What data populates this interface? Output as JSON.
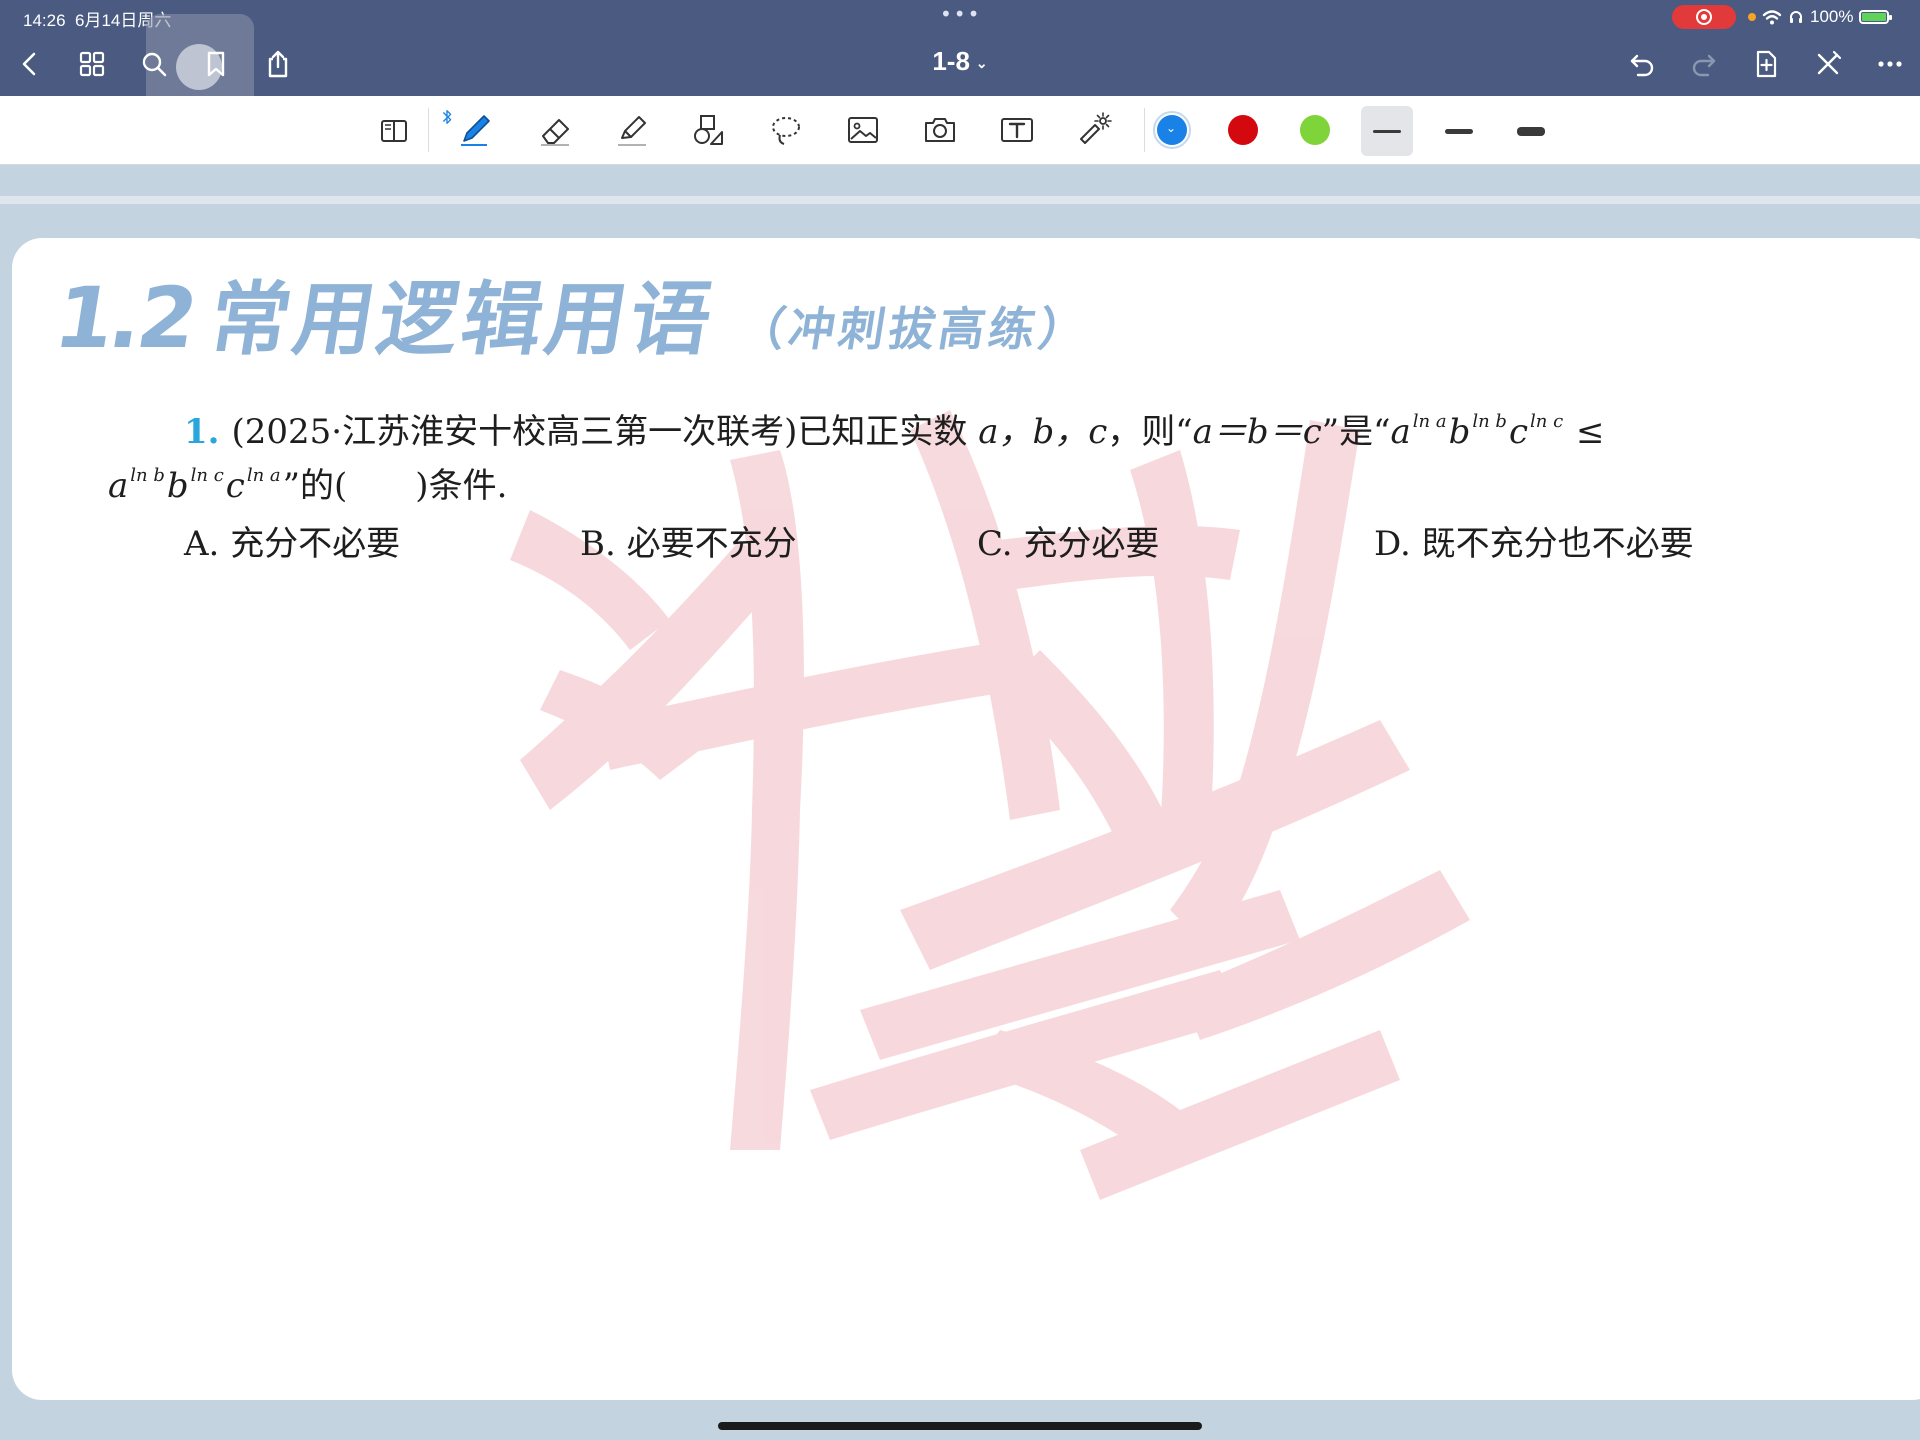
{
  "status_bar": {
    "time_date": "14:26  6月14日周六",
    "dots": "•••",
    "battery_text": "100%"
  },
  "nav": {
    "page_label": "1-8",
    "page_chevron": "⌄",
    "icons": [
      "back-icon",
      "grid-icon",
      "search-icon",
      "bookmark-icon",
      "share-icon",
      "undo-icon",
      "redo-icon",
      "add-page-icon",
      "close-tools-icon",
      "more-icon"
    ]
  },
  "toolbar": {
    "tools": [
      "read-mode-icon",
      "pen-icon",
      "eraser-icon",
      "highlighter-icon",
      "shapes-icon",
      "lasso-icon",
      "image-icon",
      "camera-icon",
      "text-icon",
      "laser-pointer-icon"
    ],
    "bluetooth_icon": "bluetooth-icon",
    "colors": [
      "#1a82e6",
      "#d3090f",
      "#7fd43a"
    ],
    "selected_color": "#1a82e6",
    "selected_stroke": "thin"
  },
  "document": {
    "section_number": "1.2",
    "section_title": "常用逻辑用语",
    "section_subtitle": "（冲刺拔高练）",
    "question": {
      "number": "1.",
      "line1_text": "(2025·江苏淮安十校高三第一次联考)已知正实数",
      "vars": "a，b，c",
      "line1_then": "，则“",
      "equality": "a＝b＝c",
      "is_text": "”是“",
      "expr_left_base_a": "a",
      "sup_ln_a": "ln a",
      "expr_left_base_b": "b",
      "sup_ln_b": "ln b",
      "expr_left_base_c": "c",
      "sup_ln_c": "ln c",
      "leq": "≤",
      "blank_text": "”的(　　)条件.",
      "options": [
        {
          "label": "A.",
          "text": "充分不必要"
        },
        {
          "label": "B.",
          "text": "必要不充分"
        },
        {
          "label": "C.",
          "text": "充分必要"
        },
        {
          "label": "D.",
          "text": "既不充分也不必要"
        }
      ]
    },
    "watermark_color": "#f6d3d8"
  }
}
